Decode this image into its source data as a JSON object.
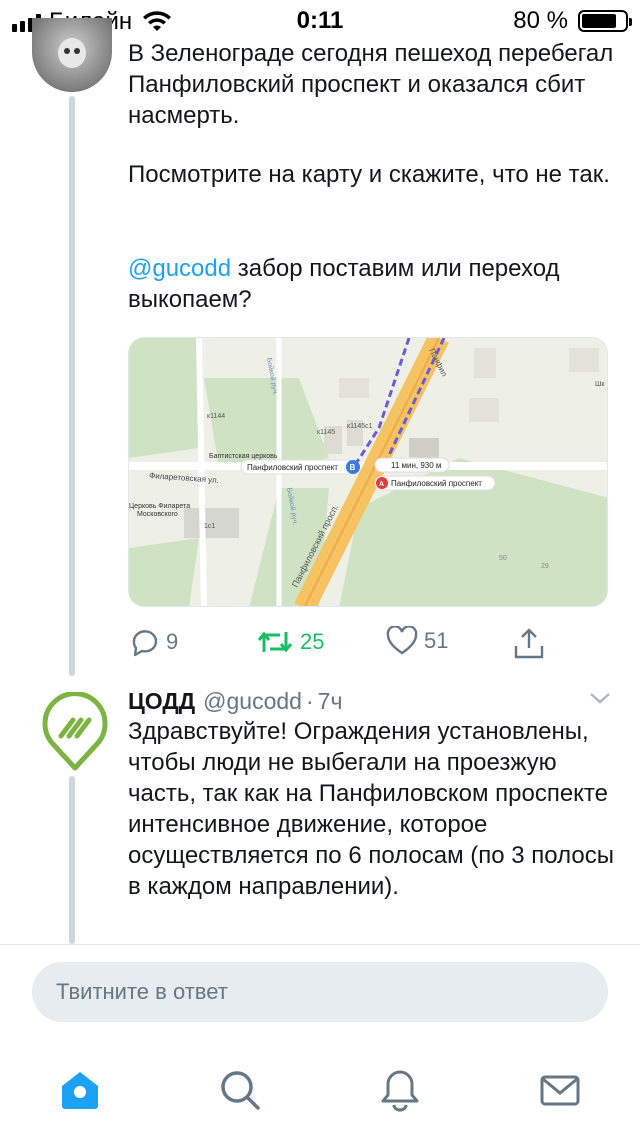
{
  "status_bar": {
    "carrier": "Билайн",
    "time": "0:11",
    "battery": "80 %",
    "battery_level": 0.8
  },
  "tweet1": {
    "text_1": "В Зеленограде сегодня пешеход перебегал Панфиловский проспект и оказался сбит насмерть.",
    "text_2": "Посмотрите на карту и скажите, что не так.",
    "mention": "@gucodd",
    "text_3": " забор поставим или переход выкопаем?",
    "map": {
      "labels": {
        "street_top": "Панфиловский проспект",
        "route_time": "11 мин, 930 м",
        "point_a": "Панфиловский проспект",
        "church": "Баптистская церковь",
        "street_left": "Филаретовская ул.",
        "church2_line1": "Церковь Филарета",
        "church2_line2": "Московского",
        "prospekt_diag": "Панфиловский просп.",
        "creek1": "Бойкой руч.",
        "creek2": "Бойкой руч.",
        "b1144": "к1144",
        "b1145": "к1145",
        "b1145c1": "к1145с1",
        "b1c1": "1с1",
        "street_top_right": "Панфил",
        "shk": "Шк",
        "n50": "50",
        "n29": "29",
        "marker_b": "B",
        "marker_a": "A"
      },
      "colors": {
        "road_main": "#f6c363",
        "route": "#6b5bd6",
        "park": "#cfe3c4",
        "marker_a": "#e9383f",
        "marker_b": "#3c7bd9"
      }
    },
    "actions": {
      "replies": "9",
      "retweets": "25",
      "likes": "51"
    }
  },
  "tweet2": {
    "name": "ЦОДД",
    "handle": "@gucodd",
    "dot": "·",
    "time": "7ч",
    "text": "Здравствуйте! Ограждения установлены, чтобы люди не выбегали на проезжую часть, так как на Панфиловском проспекте интенсивное движение, которое осуществляется по 6 полосам (по 3 полосы в каждом направлении).",
    "avatar_color": "#7cb342"
  },
  "reply": {
    "placeholder": "Твитните в ответ"
  },
  "tabbar": {
    "active_color": "#1da1f2",
    "inactive_color": "#657786",
    "items": [
      "home-icon",
      "search-icon",
      "notifications-icon",
      "messages-icon"
    ]
  }
}
